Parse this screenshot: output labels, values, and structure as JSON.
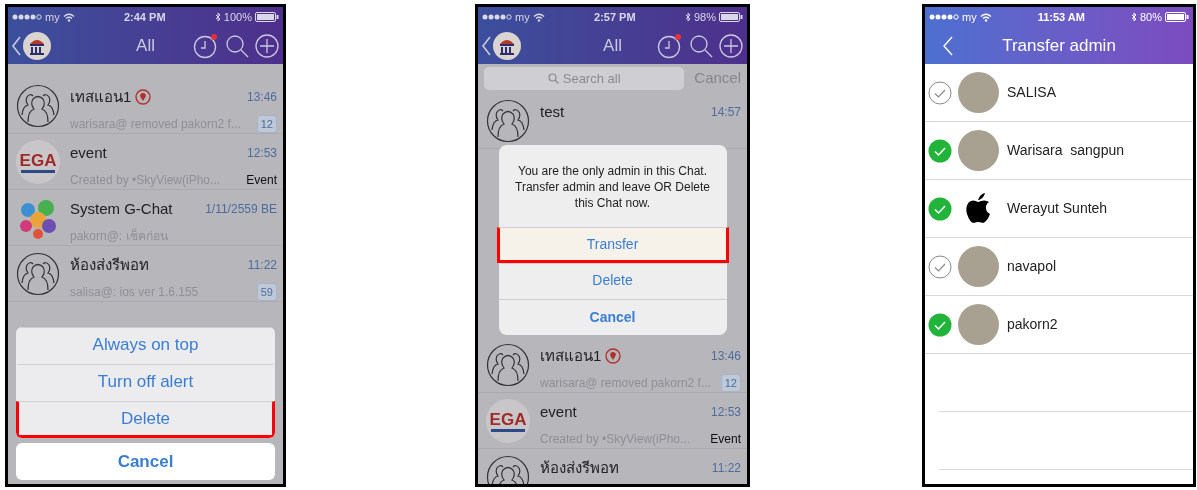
{
  "phones": [
    {
      "status": {
        "carrier": "my",
        "time": "2:44 PM",
        "battery": "100%"
      },
      "nav": {
        "kind": "chats",
        "title": "All",
        "notification_dot": true
      },
      "chats": [
        {
          "kind": "group",
          "name": "เทสแอน1",
          "location_tag": true,
          "time": "13:46",
          "preview": "warisara@ removed pakorn2 f...",
          "badge": "12"
        },
        {
          "kind": "logo",
          "avatar_label": "EGA",
          "name": "event",
          "location_tag": false,
          "time": "12:53",
          "preview": "Created by •SkyView(iPho...",
          "tag": "Event"
        },
        {
          "kind": "bubbles",
          "name": "System G-Chat",
          "location_tag": false,
          "time": "1/11/2559 BE",
          "preview": "pakorn@: เช็คก่อน"
        },
        {
          "kind": "group",
          "name": "ห้องส่งรีพอท",
          "location_tag": false,
          "time": "11:22",
          "preview": "salisa@: ios ver 1.6.155",
          "badge": "59"
        }
      ],
      "overlay": {
        "kind": "action_sheet",
        "items": [
          {
            "label": "Always on top",
            "highlighted": false
          },
          {
            "label": "Turn off alert",
            "highlighted": false
          },
          {
            "label": "Delete",
            "highlighted": true
          }
        ],
        "cancel": "Cancel"
      }
    },
    {
      "status": {
        "carrier": "my",
        "time": "2:57 PM",
        "battery": "98%"
      },
      "nav": {
        "kind": "chats",
        "title": "All",
        "notification_dot": true
      },
      "search": {
        "placeholder": "Search all",
        "cancel": "Cancel"
      },
      "chats": [
        {
          "kind": "group",
          "name": "test",
          "location_tag": false,
          "time": "14:57"
        },
        {
          "kind": "group",
          "name": "เทสแอน1",
          "location_tag": true,
          "time": "13:46",
          "preview": "warisara@ removed pakorn2 f...",
          "badge": "12"
        },
        {
          "kind": "logo",
          "avatar_label": "EGA",
          "name": "event",
          "location_tag": false,
          "time": "12:53",
          "preview": "Created by •SkyView(iPho...",
          "tag": "Event"
        },
        {
          "kind": "group",
          "name": "ห้องส่งรีพอท",
          "location_tag": false,
          "time": "11:22"
        }
      ],
      "overlay": {
        "kind": "alert",
        "message": "You are the only admin in this Chat. Transfer admin and leave OR Delete this Chat now.",
        "items": [
          {
            "label": "Transfer",
            "highlighted": true
          },
          {
            "label": "Delete",
            "highlighted": false
          }
        ],
        "cancel": "Cancel"
      }
    },
    {
      "status": {
        "carrier": "my",
        "time": "11:53 AM",
        "battery": "80%"
      },
      "nav": {
        "kind": "title",
        "title": "Transfer admin"
      },
      "members": [
        {
          "kind": "photo",
          "name": "SALISA",
          "checked": false
        },
        {
          "kind": "photo",
          "name": "Warisara  sangpun",
          "checked": true
        },
        {
          "kind": "apple",
          "name": "Werayut Sunteh",
          "checked": true
        },
        {
          "kind": "photo",
          "name": "navapol",
          "checked": false
        },
        {
          "kind": "photo",
          "name": "pakorn2",
          "checked": true
        }
      ]
    }
  ]
}
